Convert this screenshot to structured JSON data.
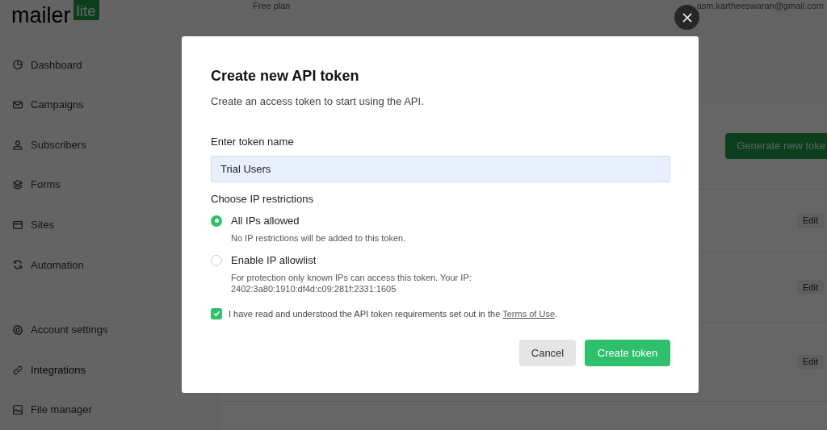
{
  "logo": {
    "word": "mailer",
    "badge": "lite"
  },
  "sidebar": {
    "items": [
      {
        "label": "Dashboard",
        "selected": false
      },
      {
        "label": "Campaigns",
        "selected": false
      },
      {
        "label": "Subscribers",
        "selected": false
      },
      {
        "label": "Forms",
        "selected": false
      },
      {
        "label": "Sites",
        "selected": false
      },
      {
        "label": "Automation",
        "selected": false
      }
    ],
    "bottom_items": [
      {
        "label": "Account settings",
        "selected": false
      },
      {
        "label": "Integrations",
        "selected": true
      },
      {
        "label": "File manager",
        "selected": false
      }
    ]
  },
  "header": {
    "plan": "Free plan",
    "email": "asm.kartheeswaran@gmail.com"
  },
  "background": {
    "generate_button": "Generate new toke",
    "rows": [
      {
        "edit": "Edit"
      },
      {
        "edit": "Edit"
      },
      {
        "edit": "Edit"
      }
    ]
  },
  "dialog": {
    "title": "Create new API token",
    "subtitle": "Create an access token to start using the API.",
    "name_label": "Enter token name",
    "name_value": "Trial Users",
    "ip_label": "Choose IP restrictions",
    "options": [
      {
        "label": "All IPs allowed",
        "description": "No IP restrictions will be added to this token.",
        "selected": true
      },
      {
        "label": "Enable IP allowlist",
        "description": "For protection only known IPs can access this token. Your IP:\n2402:3a80:1910:df4d:c09:281f:2331:1605",
        "selected": false
      }
    ],
    "terms": {
      "text": "I have read and understood the API token requirements set out in the ",
      "link": "Terms of Use",
      "suffix": ".",
      "checked": true
    },
    "buttons": [
      {
        "label": "Cancel",
        "kind": "secondary"
      },
      {
        "label": "Create token",
        "kind": "primary"
      }
    ]
  }
}
